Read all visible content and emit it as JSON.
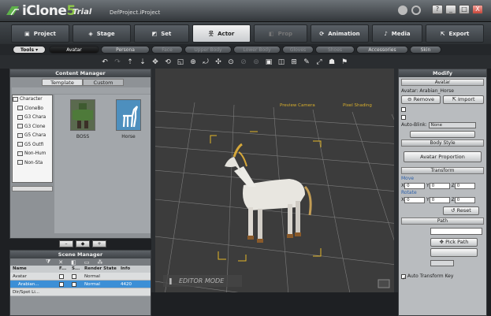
{
  "window": {
    "logo": "iClone",
    "logo_num": "5",
    "edition": "Trial",
    "project": "DefProject.iProject",
    "controls": [
      "?",
      "_",
      "□",
      "X"
    ]
  },
  "main_tabs": [
    {
      "label": "Project",
      "icon": "folder-icon"
    },
    {
      "label": "Stage",
      "icon": "stage-icon"
    },
    {
      "label": "Set",
      "icon": "set-icon"
    },
    {
      "label": "Actor",
      "icon": "actor-icon"
    },
    {
      "label": "Prop",
      "icon": "prop-icon"
    },
    {
      "label": "Animation",
      "icon": "animation-icon"
    },
    {
      "label": "Media",
      "icon": "media-icon"
    },
    {
      "label": "Export",
      "icon": "export-icon"
    }
  ],
  "sub_tabs": {
    "tools": "Tools ▾",
    "items": [
      "Avatar",
      "Persona",
      "Face",
      "Upper Body",
      "Lower Body",
      "Gloves",
      "Shoes",
      "Accessories",
      "Skin"
    ]
  },
  "content_manager": {
    "title": "Content Manager",
    "tabs": [
      "Template",
      "Custom"
    ],
    "tree": [
      "Character",
      "CloneBo",
      "G3 Chara",
      "G3 Clone",
      "G5 Chara",
      "G5 Outfi",
      "Non-Hum",
      "Non-Sta"
    ],
    "thumbs": [
      "BOSS",
      "Horse"
    ]
  },
  "scene_manager": {
    "title": "Scene Manager",
    "columns": [
      "Name",
      "F...",
      "S...",
      "Render State",
      "Info"
    ],
    "rows": [
      {
        "name": "Avatar",
        "state": "Normal",
        "info": ""
      },
      {
        "name": "Arabian...",
        "state": "Normal",
        "info": "4420"
      },
      {
        "name": "Dir/Spot Li...",
        "state": "",
        "info": ""
      }
    ]
  },
  "viewport": {
    "editor_mode": "EDITOR MODE",
    "labels": [
      "Preview Camera",
      "Pixel Shading"
    ]
  },
  "modify": {
    "title": "Modify",
    "avatar_section": "Avatar",
    "avatar_label": "Avatar:",
    "avatar_value": "Arabian_Horse",
    "remove": "Remove",
    "import": "Import",
    "auto_blink": "Auto-Blink:",
    "auto_blink_value": "None",
    "body_style": "Body Style",
    "avatar_proportion": "Avatar Proportion",
    "transform": "Transform",
    "move": "Move",
    "rotate": "Rotate",
    "axes": [
      "X",
      "Y",
      "Z"
    ],
    "zero": "0",
    "reset": "Reset",
    "path": "Path",
    "pick_path": "Pick Path",
    "auto_transform_key": "Auto Transform Key"
  },
  "colors": {
    "accent": "#3c8fd6",
    "bounding_box": "#e2b628"
  }
}
